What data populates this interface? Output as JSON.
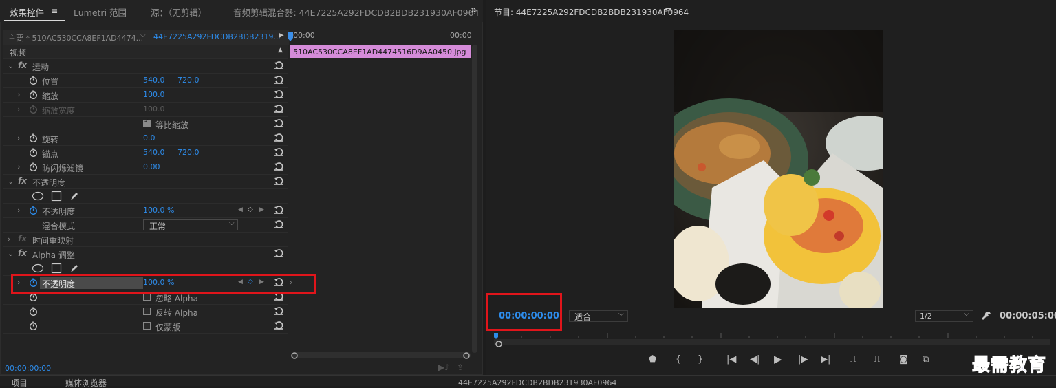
{
  "left_tabs": {
    "effect_controls": "效果控件",
    "lumetri": "Lumetri 范围",
    "source": "源：（无剪辑）",
    "audio_mixer": "音频剪辑混合器: 44E7225A292FDCDB2BDB231930AF0964",
    "more": "»"
  },
  "effect_controls": {
    "master_clip": "主要 * 510AC530CCA8EF1AD4474...",
    "sequence_clip": "44E7225A292FDCDB2BDB2319...",
    "timeline_start": "00:00",
    "timeline_end": "00:00",
    "clip_name": "510AC530CCA8EF1AD4474516D9AA0450.jpg",
    "video_header": "视频",
    "motion": "运动",
    "position_label": "位置",
    "position_x": "540.0",
    "position_y": "720.0",
    "scale_label": "缩放",
    "scale_value": "100.0",
    "scale_width_label": "缩放宽度",
    "scale_width_value": "100.0",
    "uniform_scale": "等比缩放",
    "rotation_label": "旋转",
    "rotation_value": "0.0",
    "anchor_label": "锚点",
    "anchor_x": "540.0",
    "anchor_y": "720.0",
    "flicker_label": "防闪烁滤镜",
    "flicker_value": "0.00",
    "opacity_group": "不透明度",
    "opacity_label": "不透明度",
    "opacity_value": "100.0 %",
    "blend_label": "混合模式",
    "blend_value": "正常",
    "time_remap": "时间重映射",
    "alpha_group": "Alpha 调整",
    "alpha_opacity_label": "不透明度",
    "alpha_opacity_value": "100.0 %",
    "ignore_alpha": "忽略 Alpha",
    "invert_alpha": "反转 Alpha",
    "mask_only": "仅蒙版",
    "current_time": "00:00:00:00"
  },
  "program_monitor": {
    "title": "节目: 44E7225A292FDCDB2BDB231930AF0964",
    "timecode": "00:00:00:00",
    "fit": "适合",
    "resolution": "1/2",
    "duration": "00:00:05:00"
  },
  "bottom_tabs": {
    "project": "项目",
    "media_browser": "媒体浏览器",
    "sequence": "44E7225A292FDCDB2BDB231930AF0964"
  },
  "watermark": "最需教育",
  "colors": {
    "accent_blue": "#2d8ceb",
    "clip_pink": "#d58bd9",
    "highlight_red": "#e0151b"
  }
}
